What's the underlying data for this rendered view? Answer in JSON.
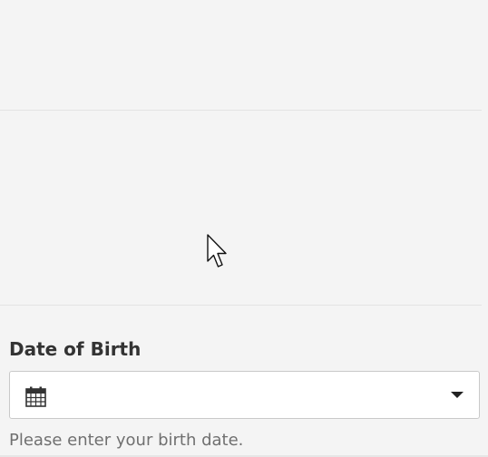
{
  "dob_field": {
    "label": "Date of Birth",
    "value": "",
    "help_text": "Please enter your birth date.",
    "leading_icon": "calendar-icon",
    "trailing_icon": "caret-down-icon"
  },
  "colors": {
    "background": "#f4f4f4",
    "input_background": "#ffffff",
    "input_border": "#c9c9c9",
    "label_text": "#333333",
    "help_text": "#707070"
  }
}
